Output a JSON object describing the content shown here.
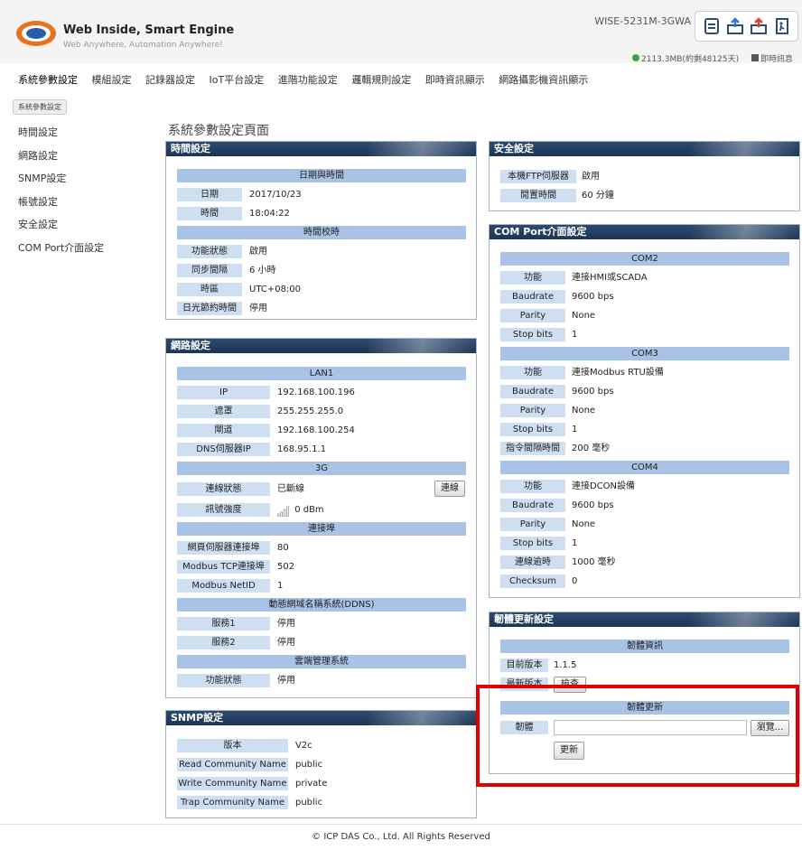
{
  "header": {
    "brand_title": "Web Inside, Smart Engine",
    "brand_subtitle": "Web Anywhere, Automation Anywhere!",
    "logo_text": "ICP DAS",
    "model": "WISE-5231M-3GWA",
    "storage": "2113.3MB(約剩48125天)",
    "realtime": "即時訊息"
  },
  "menu": [
    "系統參數設定",
    "模組設定",
    "記錄器設定",
    "IoT平台設定",
    "進階功能設定",
    "邏輯規則設定",
    "即時資訊顯示",
    "網路攝影機資訊顯示"
  ],
  "breadcrumb": "系統參數設定",
  "sidebar": [
    "時間設定",
    "網路設定",
    "SNMP設定",
    "帳號設定",
    "安全設定",
    "COM Port介面設定"
  ],
  "page_title": "系統參數設定頁面",
  "time": {
    "title": "時間設定",
    "sec1": "日期與時間",
    "date_label": "日期",
    "date_value": "2017/10/23",
    "time_label": "時間",
    "time_value": "18:04:22",
    "sec2": "時間校時",
    "func_label": "功能狀態",
    "func_value": "啟用",
    "interval_label": "同步間隔",
    "interval_value": "6 小時",
    "zone_label": "時區",
    "zone_value": "UTC+08:00",
    "dst_label": "日光節約時間",
    "dst_value": "停用"
  },
  "network": {
    "title": "網路設定",
    "sec_lan": "LAN1",
    "ip_label": "IP",
    "ip_value": "192.168.100.196",
    "mask_label": "遮罩",
    "mask_value": "255.255.255.0",
    "gw_label": "閘道",
    "gw_value": "192.168.100.254",
    "dns_label": "DNS伺服器IP",
    "dns_value": "168.95.1.1",
    "sec_3g": "3G",
    "conn_label": "連線狀態",
    "conn_value": "已斷線",
    "connect_button": "連線",
    "signal_label": "訊號強度",
    "signal_value": "0 dBm",
    "sec_port": "連接埠",
    "web_port_label": "網頁伺服器連接埠",
    "web_port_value": "80",
    "tcp_port_label": "Modbus TCP連接埠",
    "tcp_port_value": "502",
    "netid_label": "Modbus NetID",
    "netid_value": "1",
    "sec_ddns": "動態網域名稱系統(DDNS)",
    "svc1_label": "服務1",
    "svc1_value": "停用",
    "svc2_label": "服務2",
    "svc2_value": "停用",
    "sec_cloud": "雲端管理系統",
    "cloud_label": "功能狀態",
    "cloud_value": "停用"
  },
  "snmp": {
    "title": "SNMP設定",
    "version_label": "版本",
    "version_value": "V2c",
    "read_label": "Read Community Name",
    "read_value": "public",
    "write_label": "Write Community Name",
    "write_value": "private",
    "trap_label": "Trap Community Name",
    "trap_value": "public"
  },
  "security": {
    "title": "安全設定",
    "ftp_label": "本機FTP伺服器",
    "ftp_value": "啟用",
    "idle_label": "閒置時間",
    "idle_value": "60 分鐘"
  },
  "com": {
    "title": "COM Port介面設定",
    "com2": "COM2",
    "c2_func_label": "功能",
    "c2_func_value": "連接HMI或SCADA",
    "c2_baud_label": "Baudrate",
    "c2_baud_value": "9600 bps",
    "c2_parity_label": "Parity",
    "c2_parity_value": "None",
    "c2_stop_label": "Stop bits",
    "c2_stop_value": "1",
    "com3": "COM3",
    "c3_func_label": "功能",
    "c3_func_value": "連接Modbus RTU設備",
    "c3_baud_label": "Baudrate",
    "c3_baud_value": "9600 bps",
    "c3_parity_label": "Parity",
    "c3_parity_value": "None",
    "c3_stop_label": "Stop bits",
    "c3_stop_value": "1",
    "c3_cmd_label": "指令間隔時間",
    "c3_cmd_value": "200 毫秒",
    "com4": "COM4",
    "c4_func_label": "功能",
    "c4_func_value": "連接DCON設備",
    "c4_baud_label": "Baudrate",
    "c4_baud_value": "9600 bps",
    "c4_parity_label": "Parity",
    "c4_parity_value": "None",
    "c4_stop_label": "Stop bits",
    "c4_stop_value": "1",
    "c4_timeout_label": "連線逾時",
    "c4_timeout_value": "1000 毫秒",
    "c4_checksum_label": "Checksum",
    "c4_checksum_value": "0"
  },
  "firmware": {
    "title": "韌體更新設定",
    "sec_info": "韌體資訊",
    "cur_label": "目前版本",
    "cur_value": "1.1.5",
    "latest_label": "最新版本",
    "check_button": "檢查",
    "sec_update": "韌體更新",
    "fw_label": "韌體",
    "browse_button": "瀏覽...",
    "update_button": "更新"
  },
  "footer": "© ICP DAS Co., Ltd. All Rights Reserved",
  "colors": {
    "panel_header": "#1d3556",
    "section_bar": "#a9c3e6",
    "label_cell": "#cfdff2",
    "highlight": "#e00000"
  }
}
